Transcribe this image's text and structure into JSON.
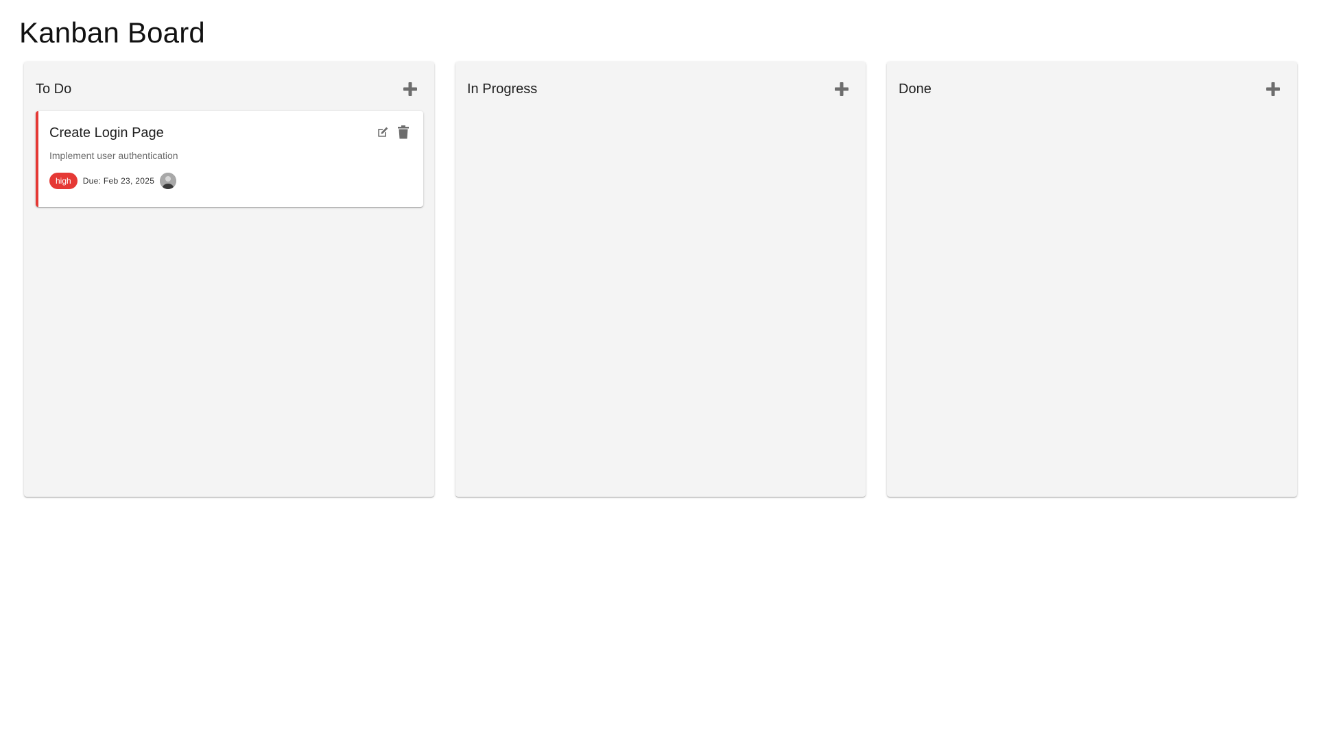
{
  "page": {
    "title": "Kanban Board"
  },
  "colors": {
    "column_bg": "#f4f4f4",
    "priority_high": "#e53935",
    "icon": "#6d6d6d"
  },
  "columns": [
    {
      "title": "To Do",
      "add_icon": "plus-icon",
      "cards": [
        {
          "title": "Create Login Page",
          "description": "Implement user authentication",
          "priority": "high",
          "due": "Due: Feb 23, 2025",
          "edit_icon": "edit-icon",
          "delete_icon": "trash-icon",
          "avatar_icon": "user-avatar"
        }
      ]
    },
    {
      "title": "In Progress",
      "add_icon": "plus-icon",
      "cards": []
    },
    {
      "title": "Done",
      "add_icon": "plus-icon",
      "cards": []
    }
  ]
}
